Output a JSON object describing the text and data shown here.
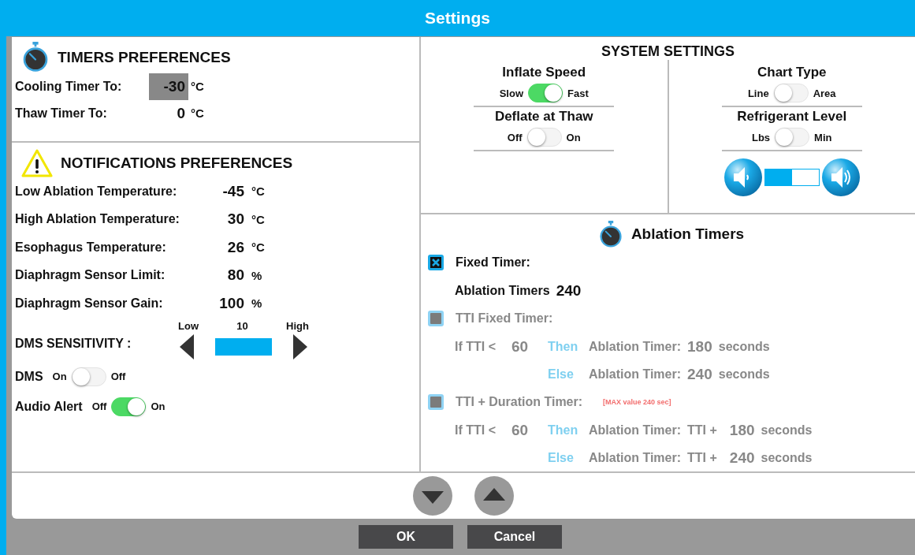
{
  "window": {
    "title": "Settings"
  },
  "timers": {
    "title": "TIMERS PREFERENCES",
    "rows": [
      {
        "label": "Cooling Timer To:",
        "value": "-30",
        "unit": "°C",
        "selected": true
      },
      {
        "label": "Thaw Timer To:",
        "value": "0",
        "unit": "°C",
        "selected": false
      }
    ]
  },
  "notifications": {
    "title": "NOTIFICATIONS PREFERENCES",
    "rows": [
      {
        "label": "Low Ablation Temperature:",
        "value": "-45",
        "unit": "°C"
      },
      {
        "label": "High Ablation Temperature:",
        "value": "30",
        "unit": "°C"
      },
      {
        "label": "Esophagus Temperature:",
        "value": "26",
        "unit": "°C"
      },
      {
        "label": "Diaphragm Sensor Limit:",
        "value": "80",
        "unit": "%"
      },
      {
        "label": "Diaphragm Sensor Gain:",
        "value": "100",
        "unit": "%"
      }
    ],
    "sensitivity": {
      "label": "DMS SENSITIVITY :",
      "low": "Low",
      "value": "10",
      "high": "High",
      "level": 1
    },
    "toggles": [
      {
        "label": "DMS",
        "left": "On",
        "right": "Off",
        "on": false
      },
      {
        "label": "Audio Alert",
        "left": "Off",
        "right": "On",
        "on": true
      }
    ]
  },
  "system": {
    "title": "SYSTEM SETTINGS",
    "columns": [
      [
        {
          "label": "Inflate Speed",
          "left": "Slow",
          "right": "Fast",
          "on": true
        },
        {
          "label": "Deflate at Thaw",
          "left": "Off",
          "right": "On",
          "on": false
        }
      ],
      [
        {
          "label": "Chart Type",
          "left": "Line",
          "right": "Area",
          "on": false
        },
        {
          "label": "Refrigerant Level",
          "left": "Lbs",
          "right": "Min",
          "on": false
        }
      ]
    ],
    "volume": {
      "level": 0.5
    }
  },
  "ablation": {
    "title": "Ablation Timers",
    "options": [
      {
        "label": "Fixed Timer:",
        "checked": true,
        "disabled": false,
        "lines": [
          {
            "label": "Ablation Timers",
            "value": "240"
          }
        ]
      },
      {
        "label": "TTI Fixed Timer:",
        "checked": false,
        "disabled": true,
        "lines": [
          {
            "prefix": "If TTI <",
            "threshold": "60",
            "keyword": "Then",
            "label": "Ablation Timer:",
            "value": "180",
            "unit": "seconds"
          },
          {
            "keyword": "Else",
            "label": "Ablation Timer:",
            "value": "240",
            "unit": "seconds"
          }
        ]
      },
      {
        "label": "TTI + Duration Timer:",
        "note": "[MAX value 240 sec]",
        "checked": false,
        "disabled": true,
        "lines": [
          {
            "prefix": "If TTI <",
            "threshold": "60",
            "keyword": "Then",
            "label": "Ablation Timer:",
            "tti": "TTI +",
            "value": "180",
            "unit": "seconds"
          },
          {
            "keyword": "Else",
            "label": "Ablation Timer:",
            "tti": "TTI +",
            "value": "240",
            "unit": "seconds"
          }
        ]
      }
    ]
  },
  "buttons": [
    {
      "label": "OK"
    },
    {
      "label": "Cancel"
    }
  ]
}
